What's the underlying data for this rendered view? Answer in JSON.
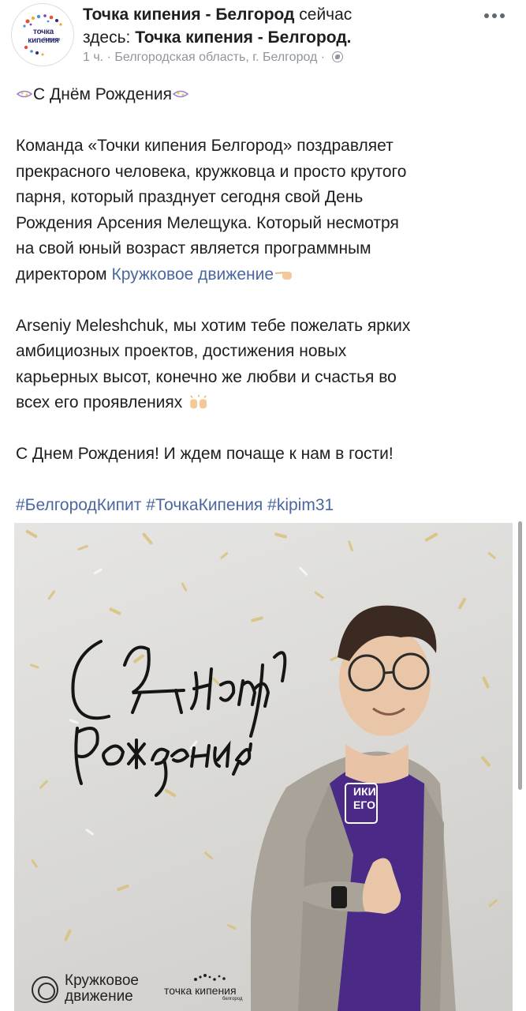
{
  "post": {
    "author": "Точка кипения - Белгород",
    "status_verb": " сейчас",
    "location_prefix": "здесь: ",
    "location": "Точка кипения - Белгород.",
    "time": "1 ч.",
    "separator": " · ",
    "place": "Белгородская область, г. Белгород",
    "separator2": " · ",
    "privacy_icon": "globe-icon",
    "more_icon": "more-options-icon"
  },
  "avatar": {
    "logo_text": "точка кипения",
    "logo_sub": "белгород"
  },
  "text": {
    "heading": "С Днём Рождения",
    "p1_lines": [
      "Команда «Точки кипения Белгород» поздравляет",
      "прекрасного человека, кружковца и просто крутого",
      "парня, который празднует сегодня свой День",
      "Рождения Арсения Мелещука. Который несмотря",
      "на свой юный возраст является программным"
    ],
    "p1_last_prefix": "директором ",
    "p1_link": "Кружковое движение",
    "p2_lines": [
      "Arseniy Meleshchuk, мы хотим тебе пожелать ярких",
      "амбициозных проектов, достижения новых",
      "карьерных высот, конечно же любви и счастья во"
    ],
    "p2_last": "всех его проявлениях ",
    "p3": "С Днем Рождения! И ждем почаще к нам в гости!",
    "hashtags": "#БелгородКипит #ТочкаКипения #kipim31"
  },
  "photo": {
    "script_line1": "С Днём",
    "script_line2": "Рождения!",
    "tshirt_text1": "ИКИ",
    "tshirt_text2": "ЕГО",
    "brand_left_line1": "Кружковое",
    "brand_left_line2": "движение",
    "brand_right": "точка кипения",
    "brand_right_sub": "белгород"
  },
  "colors": {
    "link": "#4b67a1",
    "meta": "#90949c",
    "shirt": "#4b2a87",
    "jacket": "#a9a39a"
  }
}
